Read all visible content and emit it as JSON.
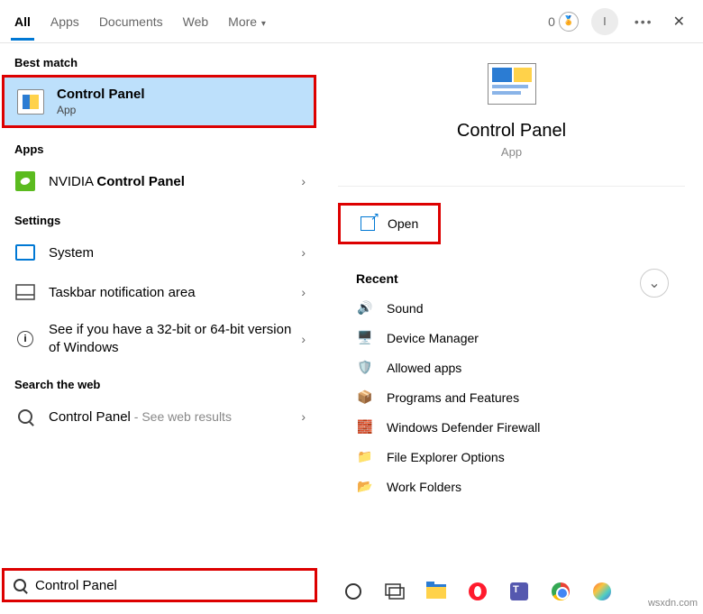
{
  "header": {
    "tabs": [
      "All",
      "Apps",
      "Documents",
      "Web",
      "More"
    ],
    "points": "0",
    "avatar": "I"
  },
  "left": {
    "best_match_label": "Best match",
    "best_match": {
      "title": "Control Panel",
      "sub": "App"
    },
    "apps_label": "Apps",
    "apps": [
      {
        "prefix": "NVIDIA ",
        "bold": "Control Panel"
      }
    ],
    "settings_label": "Settings",
    "settings": [
      {
        "text": "System"
      },
      {
        "text": "Taskbar notification area"
      },
      {
        "text": "See if you have a 32-bit or 64-bit version of Windows"
      }
    ],
    "search_web_label": "Search the web",
    "web": {
      "term": "Control Panel",
      "hint": " - See web results"
    }
  },
  "right": {
    "title": "Control Panel",
    "sub": "App",
    "open": "Open",
    "recent_label": "Recent",
    "recent": [
      "Sound",
      "Device Manager",
      "Allowed apps",
      "Programs and Features",
      "Windows Defender Firewall",
      "File Explorer Options",
      "Work Folders"
    ]
  },
  "search": {
    "value": "Control Panel"
  },
  "watermark": "wsxdn.com"
}
